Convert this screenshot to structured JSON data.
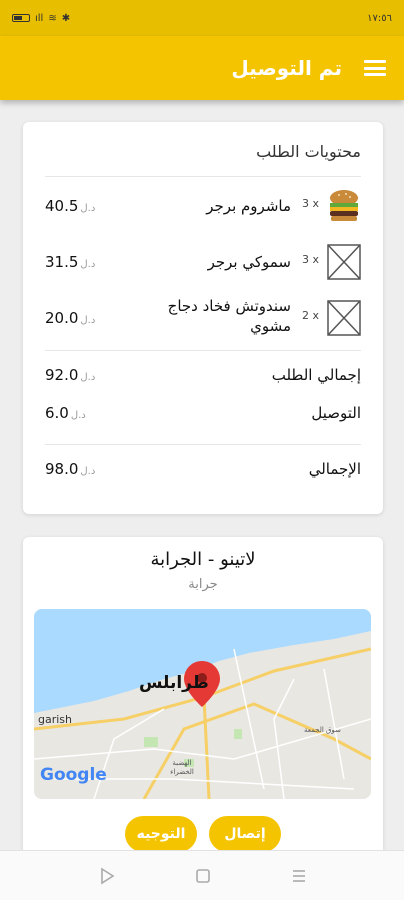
{
  "status_bar": {
    "time": "١٧:٥٦",
    "signal": "ıll",
    "wifi": "≋",
    "bt": "✱"
  },
  "app_bar": {
    "title": "تم التوصيل"
  },
  "order": {
    "title": "محتويات الطلب",
    "currency": "د.ل",
    "items": [
      {
        "qty": "3 x",
        "name": "ماشروم برجر",
        "price": "40.5",
        "image": "burger-image"
      },
      {
        "qty": "3 x",
        "name": "سموكي برجر",
        "price": "31.5",
        "image": "placeholder-image"
      },
      {
        "qty": "2 x",
        "name": "سندوتش فخاد دجاج مشوي",
        "price": "20.0",
        "image": "placeholder-image"
      }
    ],
    "subtotal_label": "إجمالي الطلب",
    "subtotal": "92.0",
    "delivery_label": "التوصيل",
    "delivery": "6.0",
    "total_label": "الإجمالي",
    "total": "98.0"
  },
  "location": {
    "title": "لاتينو - الجرابة",
    "subtitle": "جرابة",
    "map": {
      "city_label": "طرابلس",
      "district_label": "garish",
      "market_label": "سوق الجمعة",
      "area_label": "الهضبة الخضراء",
      "google_logo": "Google"
    }
  },
  "actions": {
    "call_label": "إتصال",
    "directions_label": "التوجيه"
  },
  "colors": {
    "accent": "#f5c400",
    "status": "#e8bf00",
    "marker": "#e53935"
  }
}
